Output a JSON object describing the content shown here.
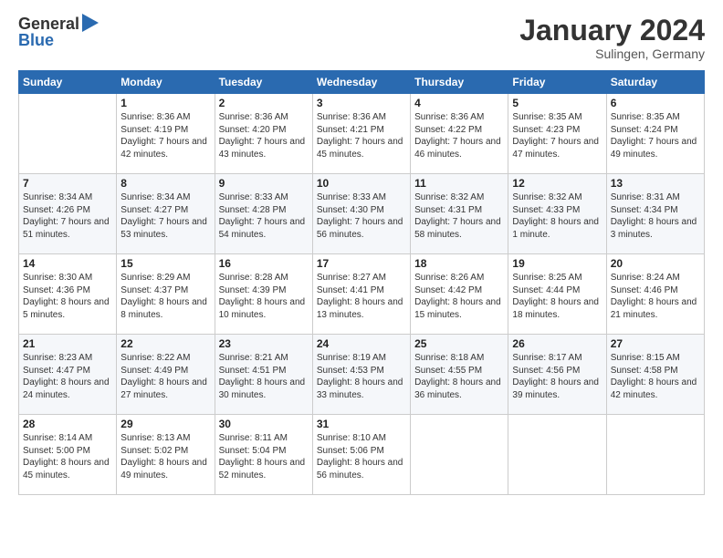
{
  "header": {
    "logo_general": "General",
    "logo_blue": "Blue",
    "month_title": "January 2024",
    "location": "Sulingen, Germany"
  },
  "weekdays": [
    "Sunday",
    "Monday",
    "Tuesday",
    "Wednesday",
    "Thursday",
    "Friday",
    "Saturday"
  ],
  "weeks": [
    [
      {
        "day": "",
        "sunrise": "",
        "sunset": "",
        "daylight": ""
      },
      {
        "day": "1",
        "sunrise": "Sunrise: 8:36 AM",
        "sunset": "Sunset: 4:19 PM",
        "daylight": "Daylight: 7 hours and 42 minutes."
      },
      {
        "day": "2",
        "sunrise": "Sunrise: 8:36 AM",
        "sunset": "Sunset: 4:20 PM",
        "daylight": "Daylight: 7 hours and 43 minutes."
      },
      {
        "day": "3",
        "sunrise": "Sunrise: 8:36 AM",
        "sunset": "Sunset: 4:21 PM",
        "daylight": "Daylight: 7 hours and 45 minutes."
      },
      {
        "day": "4",
        "sunrise": "Sunrise: 8:36 AM",
        "sunset": "Sunset: 4:22 PM",
        "daylight": "Daylight: 7 hours and 46 minutes."
      },
      {
        "day": "5",
        "sunrise": "Sunrise: 8:35 AM",
        "sunset": "Sunset: 4:23 PM",
        "daylight": "Daylight: 7 hours and 47 minutes."
      },
      {
        "day": "6",
        "sunrise": "Sunrise: 8:35 AM",
        "sunset": "Sunset: 4:24 PM",
        "daylight": "Daylight: 7 hours and 49 minutes."
      }
    ],
    [
      {
        "day": "7",
        "sunrise": "Sunrise: 8:34 AM",
        "sunset": "Sunset: 4:26 PM",
        "daylight": "Daylight: 7 hours and 51 minutes."
      },
      {
        "day": "8",
        "sunrise": "Sunrise: 8:34 AM",
        "sunset": "Sunset: 4:27 PM",
        "daylight": "Daylight: 7 hours and 53 minutes."
      },
      {
        "day": "9",
        "sunrise": "Sunrise: 8:33 AM",
        "sunset": "Sunset: 4:28 PM",
        "daylight": "Daylight: 7 hours and 54 minutes."
      },
      {
        "day": "10",
        "sunrise": "Sunrise: 8:33 AM",
        "sunset": "Sunset: 4:30 PM",
        "daylight": "Daylight: 7 hours and 56 minutes."
      },
      {
        "day": "11",
        "sunrise": "Sunrise: 8:32 AM",
        "sunset": "Sunset: 4:31 PM",
        "daylight": "Daylight: 7 hours and 58 minutes."
      },
      {
        "day": "12",
        "sunrise": "Sunrise: 8:32 AM",
        "sunset": "Sunset: 4:33 PM",
        "daylight": "Daylight: 8 hours and 1 minute."
      },
      {
        "day": "13",
        "sunrise": "Sunrise: 8:31 AM",
        "sunset": "Sunset: 4:34 PM",
        "daylight": "Daylight: 8 hours and 3 minutes."
      }
    ],
    [
      {
        "day": "14",
        "sunrise": "Sunrise: 8:30 AM",
        "sunset": "Sunset: 4:36 PM",
        "daylight": "Daylight: 8 hours and 5 minutes."
      },
      {
        "day": "15",
        "sunrise": "Sunrise: 8:29 AM",
        "sunset": "Sunset: 4:37 PM",
        "daylight": "Daylight: 8 hours and 8 minutes."
      },
      {
        "day": "16",
        "sunrise": "Sunrise: 8:28 AM",
        "sunset": "Sunset: 4:39 PM",
        "daylight": "Daylight: 8 hours and 10 minutes."
      },
      {
        "day": "17",
        "sunrise": "Sunrise: 8:27 AM",
        "sunset": "Sunset: 4:41 PM",
        "daylight": "Daylight: 8 hours and 13 minutes."
      },
      {
        "day": "18",
        "sunrise": "Sunrise: 8:26 AM",
        "sunset": "Sunset: 4:42 PM",
        "daylight": "Daylight: 8 hours and 15 minutes."
      },
      {
        "day": "19",
        "sunrise": "Sunrise: 8:25 AM",
        "sunset": "Sunset: 4:44 PM",
        "daylight": "Daylight: 8 hours and 18 minutes."
      },
      {
        "day": "20",
        "sunrise": "Sunrise: 8:24 AM",
        "sunset": "Sunset: 4:46 PM",
        "daylight": "Daylight: 8 hours and 21 minutes."
      }
    ],
    [
      {
        "day": "21",
        "sunrise": "Sunrise: 8:23 AM",
        "sunset": "Sunset: 4:47 PM",
        "daylight": "Daylight: 8 hours and 24 minutes."
      },
      {
        "day": "22",
        "sunrise": "Sunrise: 8:22 AM",
        "sunset": "Sunset: 4:49 PM",
        "daylight": "Daylight: 8 hours and 27 minutes."
      },
      {
        "day": "23",
        "sunrise": "Sunrise: 8:21 AM",
        "sunset": "Sunset: 4:51 PM",
        "daylight": "Daylight: 8 hours and 30 minutes."
      },
      {
        "day": "24",
        "sunrise": "Sunrise: 8:19 AM",
        "sunset": "Sunset: 4:53 PM",
        "daylight": "Daylight: 8 hours and 33 minutes."
      },
      {
        "day": "25",
        "sunrise": "Sunrise: 8:18 AM",
        "sunset": "Sunset: 4:55 PM",
        "daylight": "Daylight: 8 hours and 36 minutes."
      },
      {
        "day": "26",
        "sunrise": "Sunrise: 8:17 AM",
        "sunset": "Sunset: 4:56 PM",
        "daylight": "Daylight: 8 hours and 39 minutes."
      },
      {
        "day": "27",
        "sunrise": "Sunrise: 8:15 AM",
        "sunset": "Sunset: 4:58 PM",
        "daylight": "Daylight: 8 hours and 42 minutes."
      }
    ],
    [
      {
        "day": "28",
        "sunrise": "Sunrise: 8:14 AM",
        "sunset": "Sunset: 5:00 PM",
        "daylight": "Daylight: 8 hours and 45 minutes."
      },
      {
        "day": "29",
        "sunrise": "Sunrise: 8:13 AM",
        "sunset": "Sunset: 5:02 PM",
        "daylight": "Daylight: 8 hours and 49 minutes."
      },
      {
        "day": "30",
        "sunrise": "Sunrise: 8:11 AM",
        "sunset": "Sunset: 5:04 PM",
        "daylight": "Daylight: 8 hours and 52 minutes."
      },
      {
        "day": "31",
        "sunrise": "Sunrise: 8:10 AM",
        "sunset": "Sunset: 5:06 PM",
        "daylight": "Daylight: 8 hours and 56 minutes."
      },
      {
        "day": "",
        "sunrise": "",
        "sunset": "",
        "daylight": ""
      },
      {
        "day": "",
        "sunrise": "",
        "sunset": "",
        "daylight": ""
      },
      {
        "day": "",
        "sunrise": "",
        "sunset": "",
        "daylight": ""
      }
    ]
  ]
}
